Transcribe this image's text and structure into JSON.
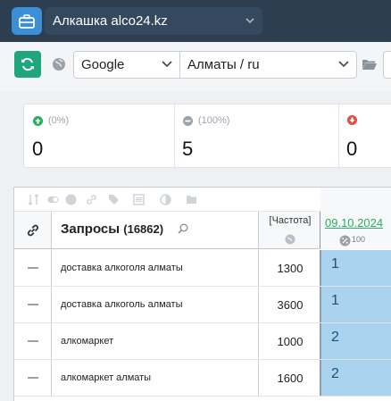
{
  "header": {
    "project_name": "Алкашка alco24.kz",
    "app_icon": "briefcase-icon"
  },
  "toolbar": {
    "refresh_icon": "refresh-icon",
    "search_engine": "Google",
    "region": "Алматы / ru"
  },
  "stats": [
    {
      "percent": "(0%)",
      "value": "0",
      "icon": "arrow-up-icon",
      "color": "#27ae60"
    },
    {
      "percent": "(100%)",
      "value": "5",
      "icon": "minus-circle-icon",
      "color": "#9aa3ab"
    },
    {
      "percent": "",
      "value": "0",
      "icon": "arrow-down-icon",
      "color": "#e74c3c"
    }
  ],
  "table": {
    "queries_label": "Запросы",
    "queries_count": "(16862)",
    "frequency_label": "[Частота]",
    "date": "09.10.2024",
    "date_sub": "100",
    "rows": [
      {
        "query": "доставка алкоголя алматы",
        "frequency": "1300",
        "position": "1"
      },
      {
        "query": "доставка алкоголь алматы",
        "frequency": "3600",
        "position": "1"
      },
      {
        "query": "алкомаркет",
        "frequency": "1000",
        "position": "2"
      },
      {
        "query": "алкомаркет алматы",
        "frequency": "1600",
        "position": "2"
      }
    ]
  }
}
